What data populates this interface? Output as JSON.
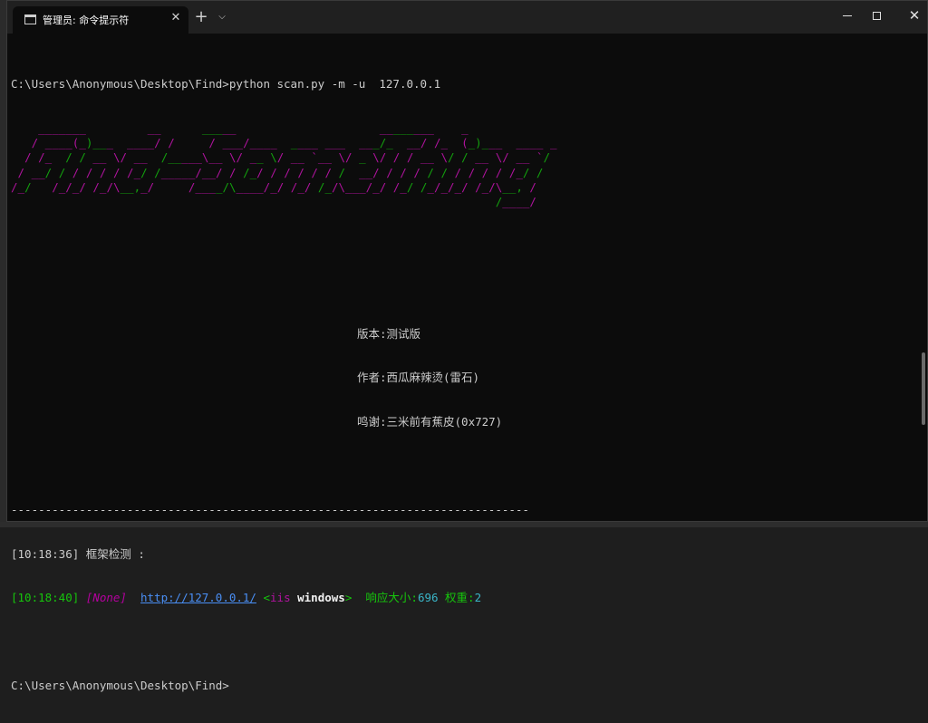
{
  "window": {
    "tab_title": "管理员: 命令提示符",
    "tab_close": "✕",
    "new_tab": "+",
    "dropdown": "⌄",
    "minimize_icon": "minimize-icon",
    "maximize_icon": "maximize-icon",
    "close_icon": "close-icon"
  },
  "terminal": {
    "command_line": "C:\\Users\\Anonymous\\Desktop\\Find>python scan.py -m -u  127.0.0.1",
    "banner": [
      {
        "g": "    _______         __      _____                     ________    _"
      },
      {
        "g": "   / ____(_)___  ____/ /     / ___/____  ____ ___  ___/_  __/ /_  (_)___  ____ _"
      },
      {
        "g": "  / /_  / / __ \\/ __  /_____\\__ \\/ __ \\/ __ `__ \\/ _ \\/ / / __ \\/ / __ \\/ __ `/"
      },
      {
        "g": " / __/ / / / / / /_/ /_____/__/ / /_/ / / / / / /  __/ / / / / / / / / / /_/ /"
      },
      {
        "g": "/_/   /_/_/ /_/\\__,_/     /____/\\____/_/ /_/ /_/\\___/_/ /_/ /_/_/_/ /_/\\__, /"
      },
      {
        "g": "                                                                       /____/"
      }
    ],
    "version_line": "版本:测试版",
    "author_line": "作者:西瓜麻辣烫(雷石)",
    "thanks_line": "鸣谢:三米前有蕉皮(0x727)",
    "separator": "----------------------------------------------------------------------------",
    "log1_time": "[10:18:36]",
    "log1_text": " 框架检测 :",
    "log2_time": "[10:18:40]",
    "log2_framework": "[None]",
    "log2_url": "http://127.0.0.1/",
    "log2_server_open": "<",
    "log2_server": "iis",
    "log2_os": " windows",
    "log2_server_close": ">",
    "log2_size_label": "响应大小:",
    "log2_size_value": "696",
    "log2_weight_label": " 权重:",
    "log2_weight_value": "2",
    "prompt": "C:\\Users\\Anonymous\\Desktop\\Find>"
  },
  "colors": {
    "banner_green": "#13a10e",
    "banner_magenta": "#b0139e",
    "link_blue": "#4a8ff5",
    "cyan": "#3ab5c8"
  }
}
